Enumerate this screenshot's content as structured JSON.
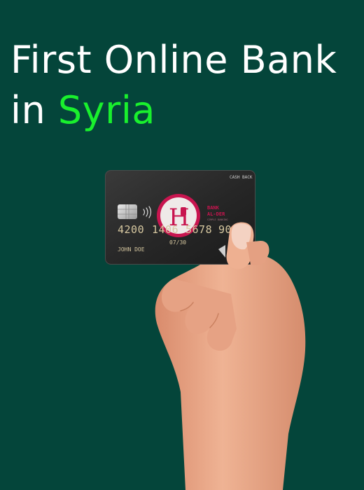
{
  "headline": {
    "line1": "First Online Bank",
    "line2_prefix": "in ",
    "line2_accent": "Syria"
  },
  "card": {
    "cashback_label": "CASH BACK",
    "bank_name_line1": "BANK",
    "bank_name_line2": "AL-DER",
    "bank_tagline": "SIMPLE BANKING",
    "number_groups": [
      "4200",
      "1406",
      "5678",
      "9010"
    ],
    "expiry": "07/30",
    "holder": "JOHN DOE",
    "logo_letter": "H"
  },
  "colors": {
    "background": "#04453a",
    "accent_text": "#19f02d",
    "card_body": "#2b2b2b",
    "logo_ring": "#c8154f",
    "skin": "#eba98a"
  }
}
